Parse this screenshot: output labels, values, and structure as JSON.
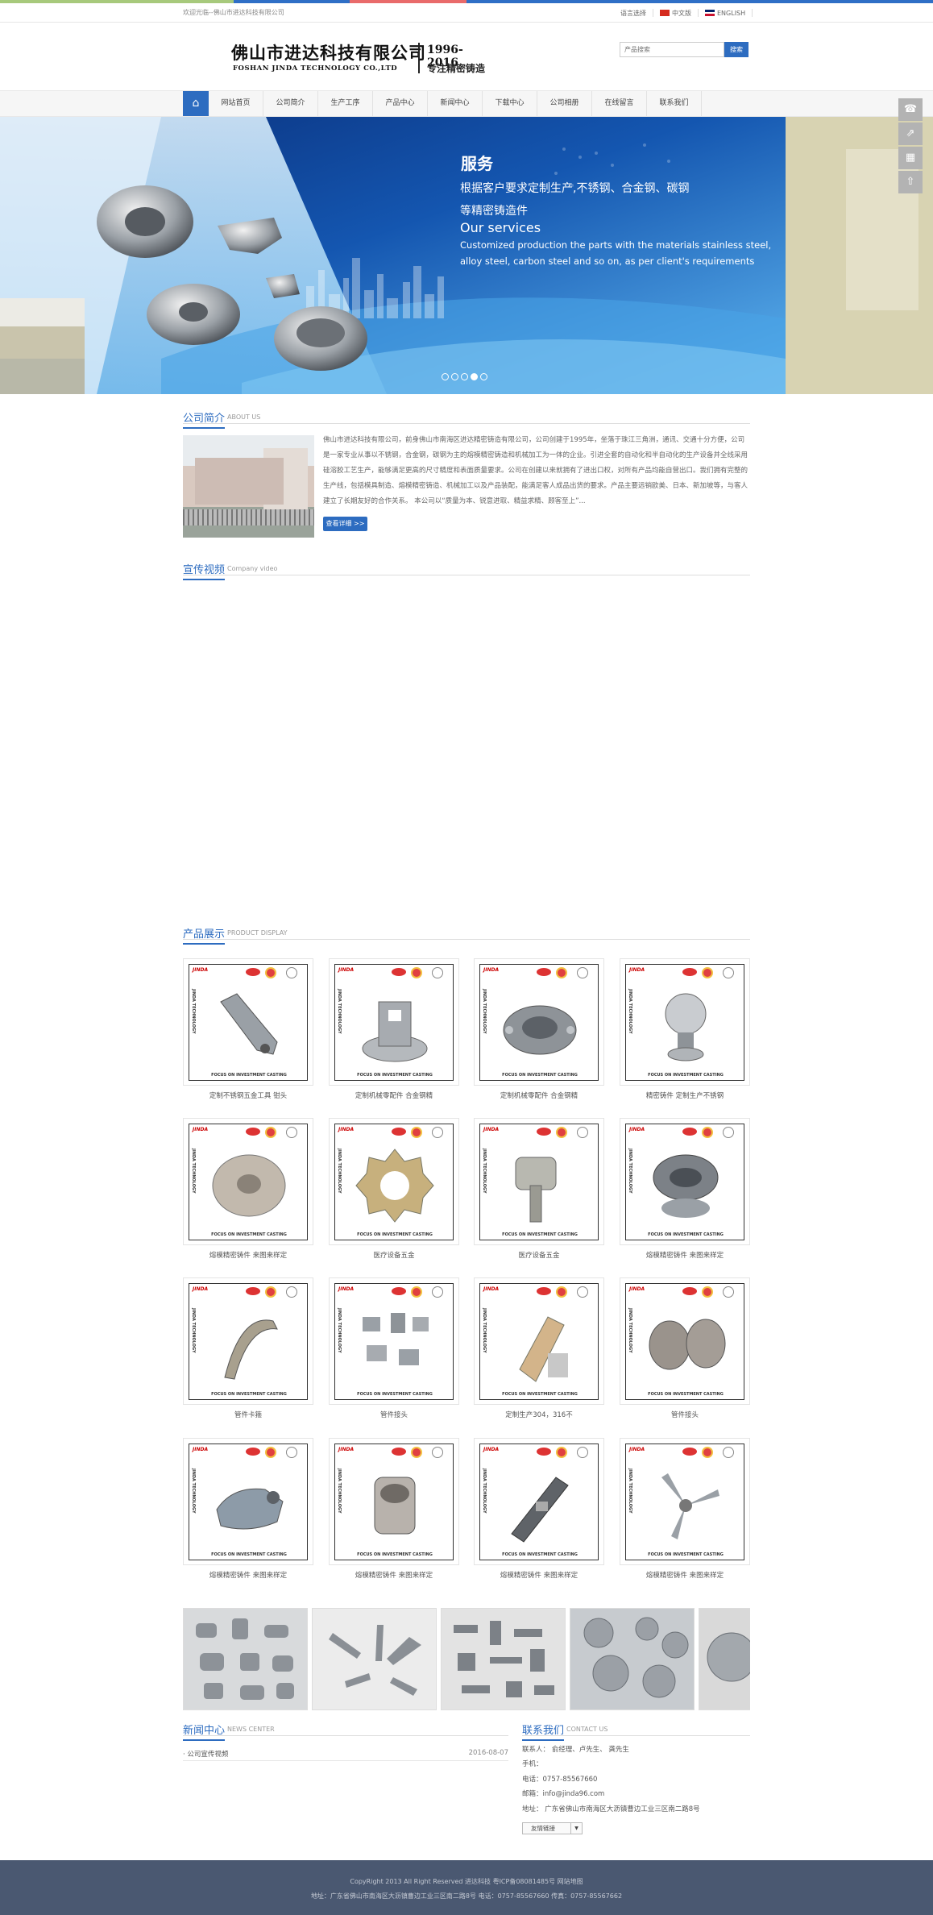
{
  "colors": {
    "accent": "#2d6cc0",
    "strip": [
      "#a7c97c",
      "#a7c97c",
      "#2f6fc6",
      "#e96b6b",
      "#2f6fc6",
      "#2f6fc6",
      "#2f6fc6",
      "#2f6fc6"
    ],
    "footer_bg": "#4a5871"
  },
  "topbar": {
    "welcome": "欢迎光临--佛山市进达科技有限公司",
    "lang_label": "语言选择",
    "lang_cn": "中文版",
    "lang_en": "ENGLISH"
  },
  "header": {
    "logo_cn": "佛山市进达科技有限公司",
    "logo_en": "FOSHAN JINDA TECHNOLOGY CO.,LTD",
    "logo_years": "1996-2016",
    "logo_slogan": "专注精密铸造",
    "search_placeholder": "产品搜索",
    "search_button": "搜索"
  },
  "nav": {
    "home_icon": "home-icon",
    "items": [
      "网站首页",
      "公司简介",
      "生产工序",
      "产品中心",
      "新闻中心",
      "下载中心",
      "公司相册",
      "在线留言",
      "联系我们"
    ]
  },
  "banner": {
    "title": "服务",
    "line1": "根据客户要求定制生产,不锈钢、合金钢、碳钢",
    "line2": "等精密铸造件",
    "line3": "Our services",
    "line4": "Customized production the parts with the materials stainless steel,",
    "line5": "alloy steel, carbon steel  and so on,  as per client's requirements",
    "slides": 5,
    "active_slide": 4
  },
  "float_icons": [
    "headset-icon",
    "share-icon",
    "qrcode-icon",
    "rocket-icon"
  ],
  "about": {
    "title_cn": "公司简介",
    "title_en": "ABOUT US",
    "text": "佛山市进达科技有限公司，前身佛山市南海区进达精密铸造有限公司，公司创建于1995年，坐落于珠江三角洲，通讯、交通十分方便，公司是一家专业从事以不锈钢，合金钢，碳钢为主的熔模精密铸造和机械加工为一体的企业。引进全套的自动化和半自动化的生产设备并全线采用硅溶胶工艺生产，能够满足更高的尺寸精度和表面质量要求。公司在创建以来就拥有了进出口权，对所有产品均能自营出口。我们拥有完整的生产线，包括模具制造、熔模精密铸造、机械加工以及产品装配，能满足客人成品出货的要求。产品主要远销欧美、日本、新加坡等，与客人建立了长期友好的合作关系。 本公司以“质量为本、锐意进取、精益求精、顾客至上”...",
    "more": "查看详细 >>"
  },
  "video": {
    "title_cn": "宣传视频",
    "title_en": "Company video"
  },
  "products": {
    "title_cn": "产品展示",
    "title_en": "PRODUCT DISPLAY",
    "badge_text": "JINDA",
    "side_text": "JINDA TECHNOLOGY",
    "foot_text": "FOCUS ON INVESTMENT CASTING",
    "items": [
      {
        "caption": "定制不锈钢五金工具 钳头",
        "shape": "arm"
      },
      {
        "caption": "定制机械零配件 合金钢精",
        "shape": "bracket"
      },
      {
        "caption": "定制机械零配件 合金钢精",
        "shape": "hub"
      },
      {
        "caption": "精密铸件 定制生产不锈钢",
        "shape": "knob"
      },
      {
        "caption": "熔模精密铸件 来图来样定",
        "shape": "disc"
      },
      {
        "caption": "医疗设备五金",
        "shape": "gear"
      },
      {
        "caption": "医疗设备五金",
        "shape": "valve"
      },
      {
        "caption": "熔模精密铸件 来图来样定",
        "shape": "impeller"
      },
      {
        "caption": "管件卡箍",
        "shape": "clamp"
      },
      {
        "caption": "管件接头",
        "shape": "fittings"
      },
      {
        "caption": "定制生产304，316不",
        "shape": "hinge"
      },
      {
        "caption": "管件接头",
        "shape": "rings"
      },
      {
        "caption": "熔模精密铸件 来图来样定",
        "shape": "housing"
      },
      {
        "caption": "熔模精密铸件 来图来样定",
        "shape": "flange"
      },
      {
        "caption": "熔模精密铸件 来图来样定",
        "shape": "latch"
      },
      {
        "caption": "熔模精密铸件 来图来样定",
        "shape": "blades"
      }
    ]
  },
  "news": {
    "title_cn": "新闻中心",
    "title_en": "NEWS CENTER",
    "items": [
      {
        "title": "· 公司宣传视频",
        "date": "2016-08-07"
      }
    ]
  },
  "contact": {
    "title_cn": "联系我们",
    "title_en": "CONTACT US",
    "lines": [
      "联系人：  俞经理、卢先生、 龚先生",
      "手机：",
      "电话：0757-85567660",
      "邮箱：info@jinda96.com",
      "地址：  广东省佛山市南海区大沥镇曹边工业三区南二路8号"
    ],
    "links_label": "友情链接"
  },
  "footer": {
    "line1": "CopyRight 2013 All Right Reserved 进达科技 粤ICP备08081485号 网站地图",
    "line2": "地址：广东省佛山市南海区大沥镇曹边工业三区南二路8号  电话：0757-85567660  传真：0757-85567662"
  }
}
